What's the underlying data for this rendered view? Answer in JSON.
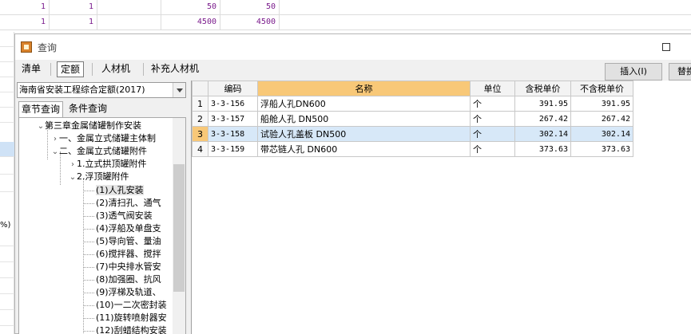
{
  "background": {
    "rows": [
      {
        "a": "1",
        "b": "1",
        "c": "50",
        "d": "50"
      },
      {
        "a": "1",
        "b": "1",
        "c": "4500",
        "d": "4500"
      }
    ],
    "side_text": "%)"
  },
  "dialog": {
    "title": "查询",
    "tabs": [
      {
        "label": "清单"
      },
      {
        "label": "定额"
      },
      {
        "label": "人材机"
      },
      {
        "label": "补充人材机"
      }
    ],
    "active_tab": 1,
    "insert_button": "插入(I)",
    "replace_button": "替换",
    "quota_library": "海南省安装工程综合定额(2017)",
    "subtabs": [
      {
        "label": "章节查询"
      },
      {
        "label": "条件查询"
      }
    ],
    "tree": [
      {
        "label": "第三章金属储罐制作安装",
        "toggle": "⌄",
        "level": 0
      },
      {
        "label": "一、金属立式储罐主体制",
        "toggle": "›",
        "level": 1
      },
      {
        "label": "二、金属立式储罐附件",
        "toggle": "⌄",
        "level": 1
      },
      {
        "label": "1.立式拱顶罐附件",
        "toggle": "›",
        "level": 2
      },
      {
        "label": "2.浮顶罐附件",
        "toggle": "⌄",
        "level": 2
      },
      {
        "label": "(1)人孔安装",
        "toggle": "",
        "level": 3,
        "selected": true
      },
      {
        "label": "(2)清扫孔、通气",
        "toggle": "",
        "level": 3
      },
      {
        "label": "(3)透气阀安装",
        "toggle": "",
        "level": 3
      },
      {
        "label": "(4)浮船及单盘支",
        "toggle": "",
        "level": 3
      },
      {
        "label": "(5)导向管、量油",
        "toggle": "",
        "level": 3
      },
      {
        "label": "(6)搅拌器、搅拌",
        "toggle": "",
        "level": 3
      },
      {
        "label": "(7)中央排水管安",
        "toggle": "",
        "level": 3
      },
      {
        "label": "(8)加强圈、抗风",
        "toggle": "",
        "level": 3
      },
      {
        "label": "(9)浮梯及轨道、",
        "toggle": "",
        "level": 3
      },
      {
        "label": "(10)一二次密封装",
        "toggle": "",
        "level": 3
      },
      {
        "label": "(11)旋转喷射器安",
        "toggle": "",
        "level": 3
      },
      {
        "label": "(12)刮蜡结构安装",
        "toggle": "",
        "level": 3
      }
    ],
    "grid": {
      "columns": [
        "编码",
        "名称",
        "单位",
        "含税单价",
        "不含税单价"
      ],
      "rows": [
        {
          "idx": "1",
          "code": "3-3-156",
          "name": "浮船人孔DN600",
          "unit": "个",
          "price_tax": "391.95",
          "price_notax": "391.95"
        },
        {
          "idx": "2",
          "code": "3-3-157",
          "name": "船舱人孔 DN500",
          "unit": "个",
          "price_tax": "267.42",
          "price_notax": "267.42"
        },
        {
          "idx": "3",
          "code": "3-3-158",
          "name": "试验人孔盖板 DN500",
          "unit": "个",
          "price_tax": "302.14",
          "price_notax": "302.14",
          "selected": true
        },
        {
          "idx": "4",
          "code": "3-3-159",
          "name": "带芯链人孔 DN600",
          "unit": "个",
          "price_tax": "373.63",
          "price_notax": "373.63"
        }
      ]
    }
  }
}
